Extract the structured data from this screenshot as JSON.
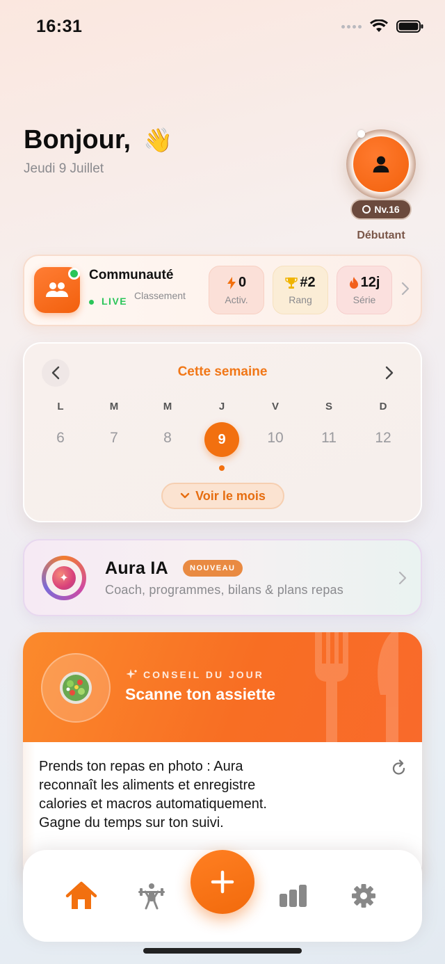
{
  "status_bar": {
    "time": "16:31"
  },
  "header": {
    "greeting": "Bonjour,",
    "emoji": "👋",
    "date": "Jeudi 9 Juillet",
    "level": "Nv.16",
    "rank_label": "Débutant"
  },
  "community": {
    "title": "Communauté",
    "live": "LIVE",
    "subtitle": "Classement",
    "stats": [
      {
        "value": "0",
        "label": "Activ.",
        "icon": "lightning-icon",
        "bg": "#fbe1d9"
      },
      {
        "value": "#2",
        "label": "Rang",
        "icon": "trophy-icon",
        "bg": "#fbeed8"
      },
      {
        "value": "12j",
        "label": "Série",
        "icon": "flame-icon",
        "bg": "#fbe1df"
      }
    ]
  },
  "calendar": {
    "title": "Cette semaine",
    "days": [
      {
        "letter": "L",
        "num": "6"
      },
      {
        "letter": "M",
        "num": "7"
      },
      {
        "letter": "M",
        "num": "8"
      },
      {
        "letter": "J",
        "num": "9"
      },
      {
        "letter": "V",
        "num": "10"
      },
      {
        "letter": "S",
        "num": "11"
      },
      {
        "letter": "D",
        "num": "12"
      }
    ],
    "selected_index": 3,
    "month_button": "Voir le mois"
  },
  "aura": {
    "title": "Aura IA",
    "badge": "NOUVEAU",
    "subtitle": "Coach, programmes, bilans & plans repas"
  },
  "tip": {
    "kicker": "CONSEIL DU JOUR",
    "title": "Scanne ton assiette",
    "body": "Prends ton repas en photo : Aura reconnaît les aliments et enregistre calories et macros automatiquement. Gagne du temps sur ton suivi."
  },
  "nav": {
    "items": [
      "home-icon",
      "workout-icon",
      "add-icon",
      "stats-icon",
      "settings-icon"
    ],
    "active": "home-icon"
  },
  "colors": {
    "accent": "#f2700f",
    "live": "#2ac559"
  }
}
